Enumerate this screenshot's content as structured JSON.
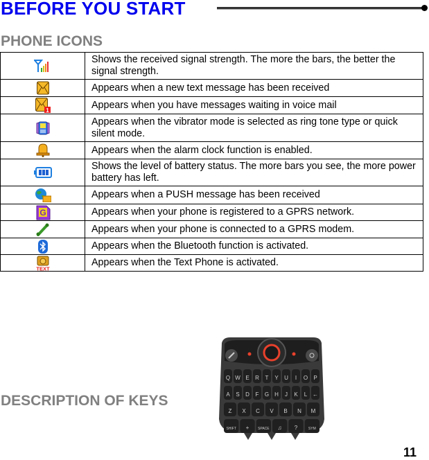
{
  "page": {
    "title": "BEFORE YOU START",
    "section_phone_icons": "PHONE ICONS",
    "section_keys": "DESCRIPTION OF KEYS",
    "page_number": "11"
  },
  "phone_icons": [
    {
      "icon": "signal-strength-icon",
      "description": "Shows the received signal strength. The more the bars, the better the signal strength."
    },
    {
      "icon": "new-message-icon",
      "description": "Appears when a new text message has been received"
    },
    {
      "icon": "voice-mail-icon",
      "description": "Appears when you have messages waiting in voice mail"
    },
    {
      "icon": "vibrate-mode-icon",
      "description": "Appears when the vibrator mode is selected as ring tone type or quick silent mode."
    },
    {
      "icon": "alarm-bell-icon",
      "description": "Appears when the alarm clock function is enabled."
    },
    {
      "icon": "battery-icon",
      "description": "Shows the level of battery status. The more bars you see, the more power battery has left."
    },
    {
      "icon": "push-message-icon",
      "description": "Appears when a PUSH message has been received"
    },
    {
      "icon": "gprs-network-icon",
      "description": "Appears when your phone is registered to a GPRS network."
    },
    {
      "icon": "gprs-modem-icon",
      "description": "Appears when your phone is connected to a GPRS modem."
    },
    {
      "icon": "bluetooth-icon",
      "description": "Appears when the Bluetooth function is activated."
    },
    {
      "icon": "text-phone-icon",
      "description": "Appears when the Text Phone is activated.",
      "badge": "TEXT"
    }
  ],
  "icon_glyphs": {
    "voice_mail_badge": "1",
    "gprs_letter": "G"
  },
  "keypad": {
    "image": "qwerty-keypad-image",
    "rows": [
      [
        "Q",
        "W",
        "E",
        "R",
        "T",
        "Y",
        "U",
        "I",
        "O",
        "P"
      ],
      [
        "A",
        "S",
        "D",
        "F",
        "G",
        "H",
        "J",
        "K",
        "L",
        "←"
      ],
      [
        "Z",
        "X",
        "C",
        "V",
        "B",
        "N",
        "M"
      ],
      [
        "SHIFT",
        "+",
        "SPACE",
        "♫",
        "?",
        "SYM"
      ]
    ]
  },
  "colors": {
    "title": "#0000ee",
    "section": "#808080"
  }
}
